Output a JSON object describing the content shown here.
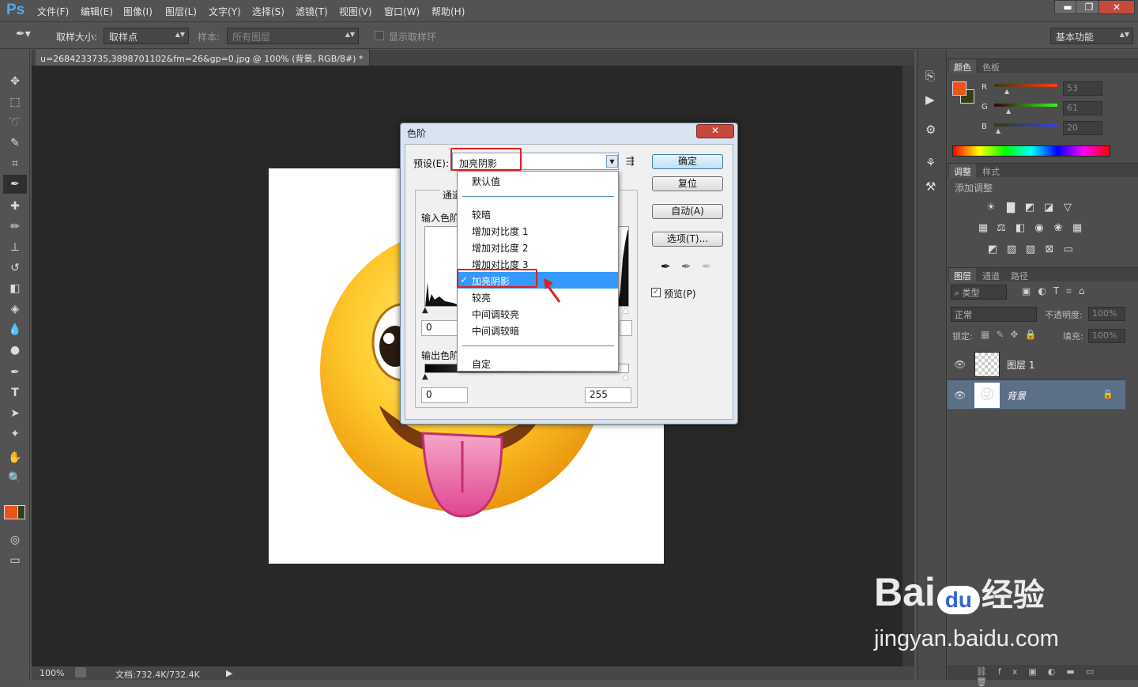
{
  "app": {
    "logo": "Ps"
  },
  "menu": [
    "文件(F)",
    "编辑(E)",
    "图像(I)",
    "图层(L)",
    "文字(Y)",
    "选择(S)",
    "滤镜(T)",
    "视图(V)",
    "窗口(W)",
    "帮助(H)"
  ],
  "window_buttons": {
    "minimize": "▬",
    "restore": "❐",
    "close": "✕"
  },
  "options": {
    "sample_size_label": "取样大小:",
    "sample_size_value": "取样点",
    "sample_label": "样本:",
    "sample_value": "所有图层",
    "show_ring_label": "显示取样环",
    "workspace": "基本功能"
  },
  "document": {
    "tab_title": "u=2684233735,3898701102&fm=26&gp=0.jpg @ 100% (背景, RGB/8#) *",
    "zoom": "100%",
    "doc_size": "文档:732.4K/732.4K"
  },
  "color_panel": {
    "tabs": [
      "颜色",
      "色板"
    ],
    "r_label": "R",
    "g_label": "G",
    "b_label": "B",
    "r_value": "53",
    "g_value": "61",
    "b_value": "20",
    "fg_color": "#e8541a",
    "bg_color": "#353d14"
  },
  "adjust_panel": {
    "tabs": [
      "调整",
      "样式"
    ],
    "title": "添加调整"
  },
  "layers_panel": {
    "tabs": [
      "图层",
      "通道",
      "路径"
    ],
    "filter_label": "类型",
    "blend_mode": "正常",
    "opacity_label": "不透明度:",
    "opacity_value": "100%",
    "lock_label": "锁定:",
    "fill_label": "填充:",
    "fill_value": "100%",
    "layers": [
      {
        "name": "图层 1",
        "selected": false
      },
      {
        "name": "背景",
        "selected": true
      }
    ]
  },
  "levels_dialog": {
    "title": "色阶",
    "close": "✕",
    "preset_label": "预设(E):",
    "preset_value": "加亮阴影",
    "channel_label": "通道",
    "input_levels_label": "输入色阶",
    "output_levels_label": "输出色阶",
    "input_black": "0",
    "output_black": "0",
    "output_white": "255",
    "buttons": {
      "ok": "确定",
      "reset": "复位",
      "auto": "自动(A)",
      "options": "选项(T)..."
    },
    "preview_label": "预览(P)",
    "preview_checked": true
  },
  "preset_dropdown": {
    "items": [
      "默认值",
      "较暗",
      "增加对比度 1",
      "增加对比度 2",
      "增加对比度 3",
      "加亮阴影",
      "较亮",
      "中间调较亮",
      "中间调较暗",
      "自定"
    ],
    "selected": "加亮阴影",
    "check": "✓"
  },
  "watermark": {
    "brand": "Bai",
    "brand2": "du",
    "cn": "经验",
    "url": "jingyan.baidu.com"
  },
  "colors": {
    "accent_highlight": "#3399ff",
    "annotation_red": "#e02020"
  }
}
